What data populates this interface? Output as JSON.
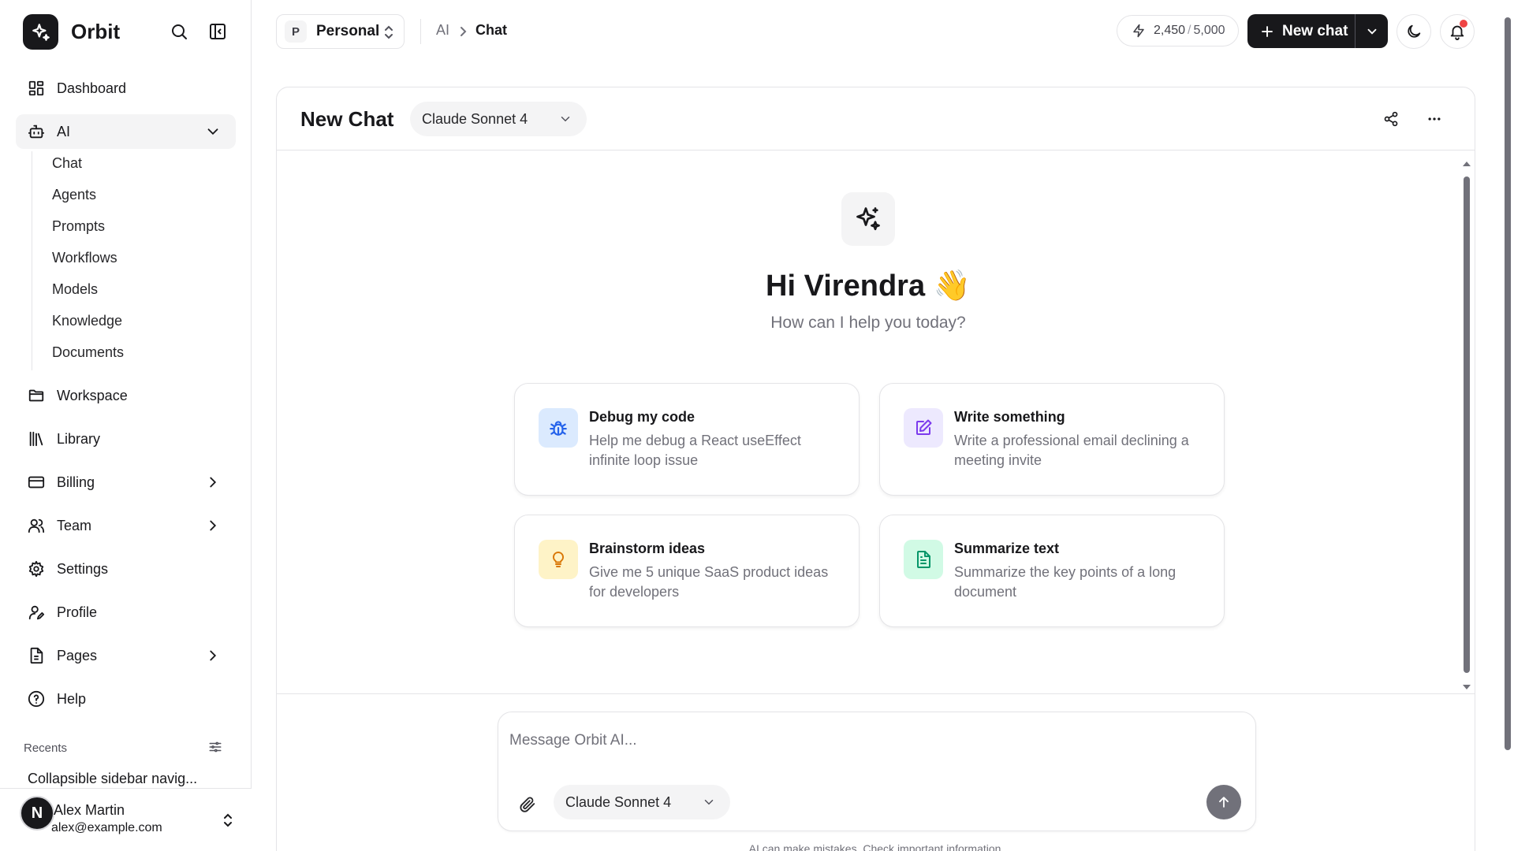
{
  "brand": {
    "name": "Orbit",
    "icon": "sparkles-icon"
  },
  "sidebar": {
    "items": [
      {
        "label": "Dashboard",
        "icon": "dashboard-icon"
      },
      {
        "label": "AI",
        "icon": "bot-icon",
        "expanded": true
      },
      {
        "label": "Workspace",
        "icon": "folder-icon"
      },
      {
        "label": "Library",
        "icon": "library-icon"
      },
      {
        "label": "Billing",
        "icon": "credit-card-icon",
        "has_children": true
      },
      {
        "label": "Team",
        "icon": "users-icon",
        "has_children": true
      },
      {
        "label": "Settings",
        "icon": "gear-icon"
      },
      {
        "label": "Profile",
        "icon": "user-pen-icon"
      },
      {
        "label": "Pages",
        "icon": "file-icon",
        "has_children": true
      },
      {
        "label": "Help",
        "icon": "help-icon"
      }
    ],
    "ai_subitems": [
      "Chat",
      "Agents",
      "Prompts",
      "Workflows",
      "Models",
      "Knowledge",
      "Documents"
    ],
    "recents_label": "Recents",
    "recents": [
      "Collapsible sidebar navig..."
    ],
    "user": {
      "initial": "N",
      "name": "Alex Martin",
      "email": "alex@example.com"
    }
  },
  "topbar": {
    "workspace": {
      "badge": "P",
      "name": "Personal"
    },
    "breadcrumb": [
      "AI",
      "Chat"
    ],
    "credits": {
      "used": "2,450",
      "total": "5,000"
    },
    "new_chat_label": "New chat",
    "has_notification": true
  },
  "chat": {
    "title": "New Chat",
    "model": "Claude Sonnet 4",
    "greeting": "Hi Virendra",
    "greeting_emoji": "👋",
    "subgreeting": "How can I help you today?",
    "suggestions": [
      {
        "title": "Debug my code",
        "desc": "Help me debug a React useEffect infinite loop issue",
        "icon": "bug-icon",
        "color": "#2563eb",
        "bg": "#dbeafe"
      },
      {
        "title": "Write something",
        "desc": "Write a professional email declining a meeting invite",
        "icon": "edit-icon",
        "color": "#7c3aed",
        "bg": "#ede9fe"
      },
      {
        "title": "Brainstorm ideas",
        "desc": "Give me 5 unique SaaS product ideas for developers",
        "icon": "lightbulb-icon",
        "color": "#d97706",
        "bg": "#fef3c7"
      },
      {
        "title": "Summarize text",
        "desc": "Summarize the key points of a long document",
        "icon": "document-icon",
        "color": "#059669",
        "bg": "#d1fae5"
      }
    ],
    "composer": {
      "placeholder": "Message Orbit AI...",
      "model": "Claude Sonnet 4"
    },
    "disclaimer": "AI can make mistakes. Check important information."
  },
  "colors": {
    "primary": "#18181b",
    "muted": "#71717a",
    "border": "#e4e4e7",
    "notification": "#ef4444"
  }
}
